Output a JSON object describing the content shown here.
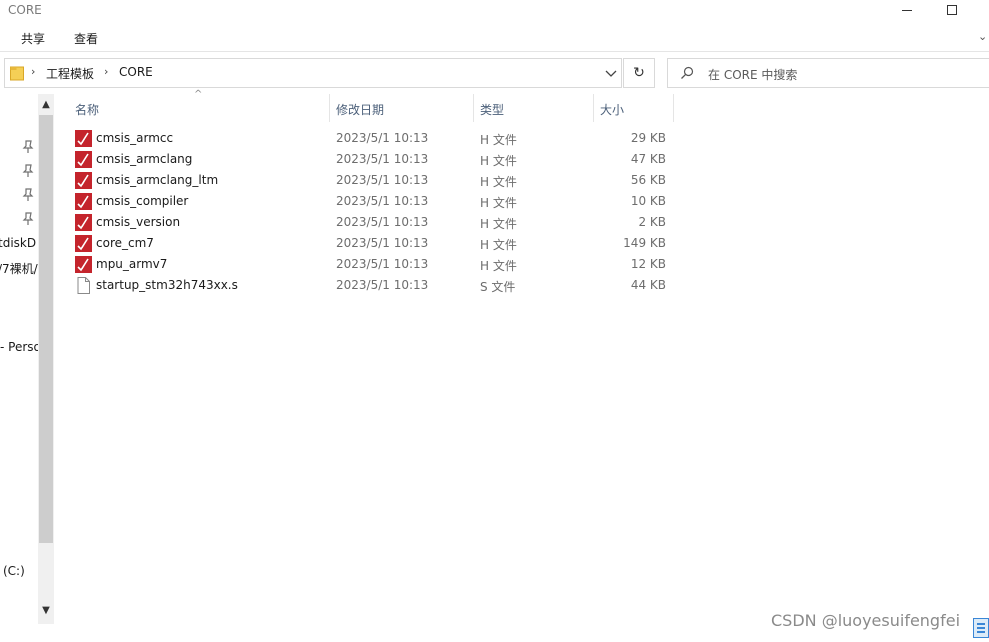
{
  "window": {
    "title": "CORE"
  },
  "ribbon": {
    "tabs": [
      "共享",
      "查看"
    ]
  },
  "address": {
    "crumbs": [
      "工程模板",
      "CORE"
    ]
  },
  "search": {
    "placeholder": "在 CORE 中搜索"
  },
  "nav": {
    "labels": [
      "tdiskD",
      "/7裸机/",
      "- Perso",
      "(C:)"
    ]
  },
  "columns": {
    "name": "名称",
    "date": "修改日期",
    "type": "类型",
    "size": "大小"
  },
  "files": [
    {
      "name": "cmsis_armcc",
      "date": "2023/5/1 10:13",
      "type": "H 文件",
      "size": "29 KB",
      "icon": "h-file-icon"
    },
    {
      "name": "cmsis_armclang",
      "date": "2023/5/1 10:13",
      "type": "H 文件",
      "size": "47 KB",
      "icon": "h-file-icon"
    },
    {
      "name": "cmsis_armclang_ltm",
      "date": "2023/5/1 10:13",
      "type": "H 文件",
      "size": "56 KB",
      "icon": "h-file-icon"
    },
    {
      "name": "cmsis_compiler",
      "date": "2023/5/1 10:13",
      "type": "H 文件",
      "size": "10 KB",
      "icon": "h-file-icon"
    },
    {
      "name": "cmsis_version",
      "date": "2023/5/1 10:13",
      "type": "H 文件",
      "size": "2 KB",
      "icon": "h-file-icon"
    },
    {
      "name": "core_cm7",
      "date": "2023/5/1 10:13",
      "type": "H 文件",
      "size": "149 KB",
      "icon": "h-file-icon"
    },
    {
      "name": "mpu_armv7",
      "date": "2023/5/1 10:13",
      "type": "H 文件",
      "size": "12 KB",
      "icon": "h-file-icon"
    },
    {
      "name": "startup_stm32h743xx.s",
      "date": "2023/5/1 10:13",
      "type": "S 文件",
      "size": "44 KB",
      "icon": "blank-file-icon"
    }
  ],
  "watermark": "CSDN @luoyesuifengfei",
  "colors": {
    "hfile_icon": "#c4242c",
    "header_text": "#4c607a",
    "accent": "#3a86d6"
  }
}
